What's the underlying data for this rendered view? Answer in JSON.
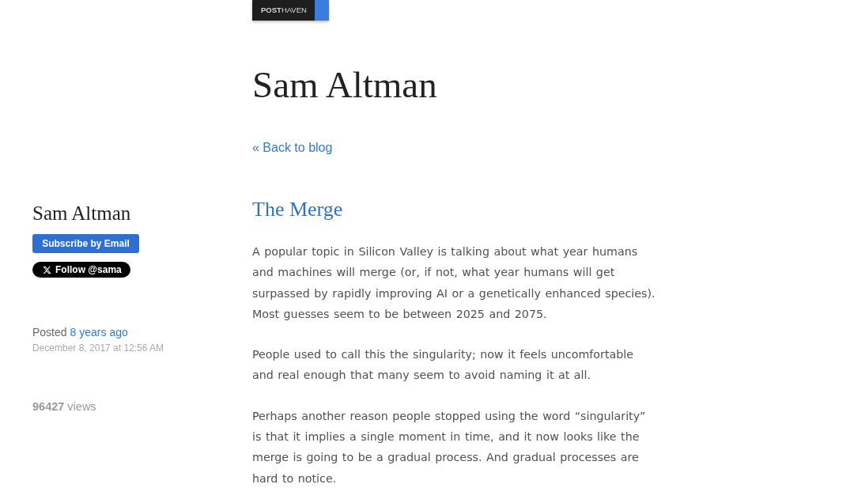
{
  "badge": {
    "label": "**POST**HAVEN"
  },
  "blog_title": "Sam Altman",
  "back_link": "« Back to blog",
  "sidebar": {
    "author": "Sam Altman",
    "subscribe_button": "Subscribe by Email",
    "follow_button": "Follow @sama",
    "posted_label": "Posted",
    "posted_ago": "8 years ago",
    "posted_date": "December 8, 2017 at 12:56 AM",
    "views": "**96427** views"
  },
  "post": {
    "title": "The Merge",
    "paragraphs": [
      "A popular topic in Silicon Valley is talking about what year humans and machines will merge (or, if not, what year humans will get surpassed by rapidly improving AI or a genetically enhanced species). Most guesses seem to be between 2025 and 2075.",
      "People used to call this the singularity; now it feels uncomfortable and real enough that many seem to avoid naming it at all.",
      "Perhaps another reason people stopped using the word “singularity” is that it implies a single moment in time, and it now looks like the merge is going to be a gradual process. And gradual processes are hard to notice."
    ]
  }
}
